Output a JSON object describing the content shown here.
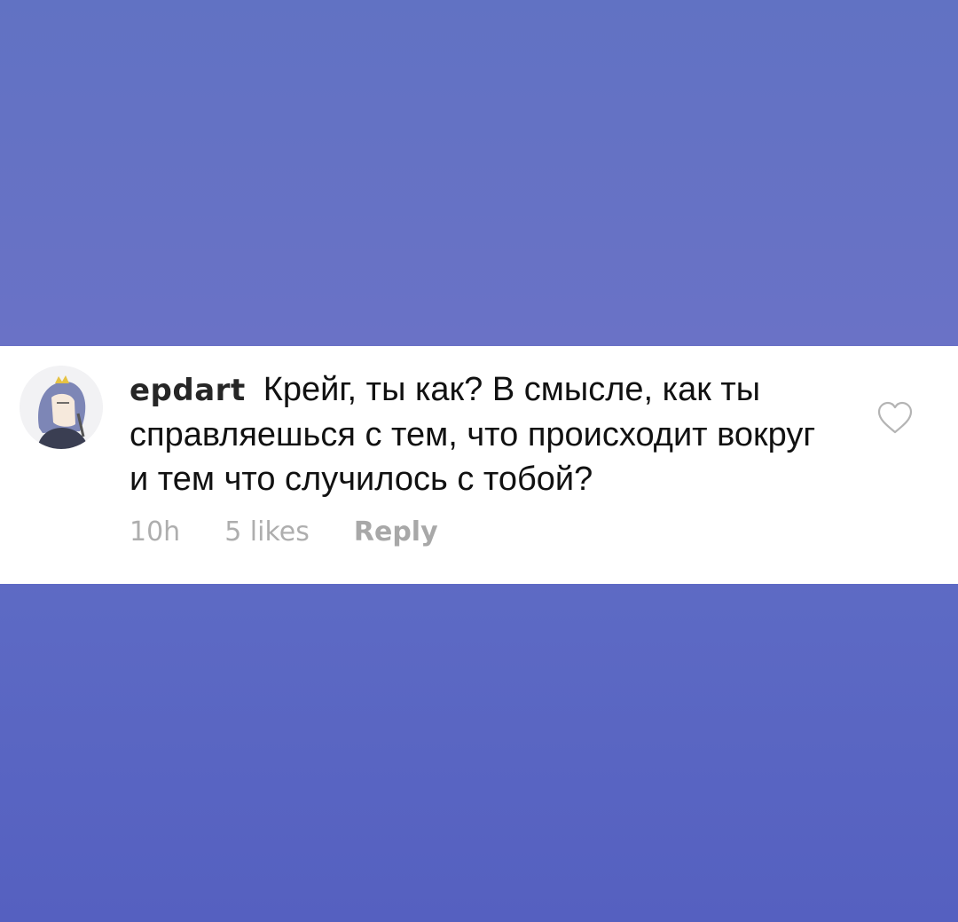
{
  "comment": {
    "username": "epdart",
    "text": "Крейг, ты как? В смысле, как ты справляешься с тем, что происходит вокруг и тем что случилось с тобой?",
    "time": "10h",
    "likes": "5 likes",
    "reply_label": "Reply",
    "avatar_icon": "user-avatar-icon",
    "like_icon": "heart-outline-icon"
  },
  "colors": {
    "background": "#6172c3",
    "card": "#ffffff",
    "meta_text": "#aeaeae"
  }
}
